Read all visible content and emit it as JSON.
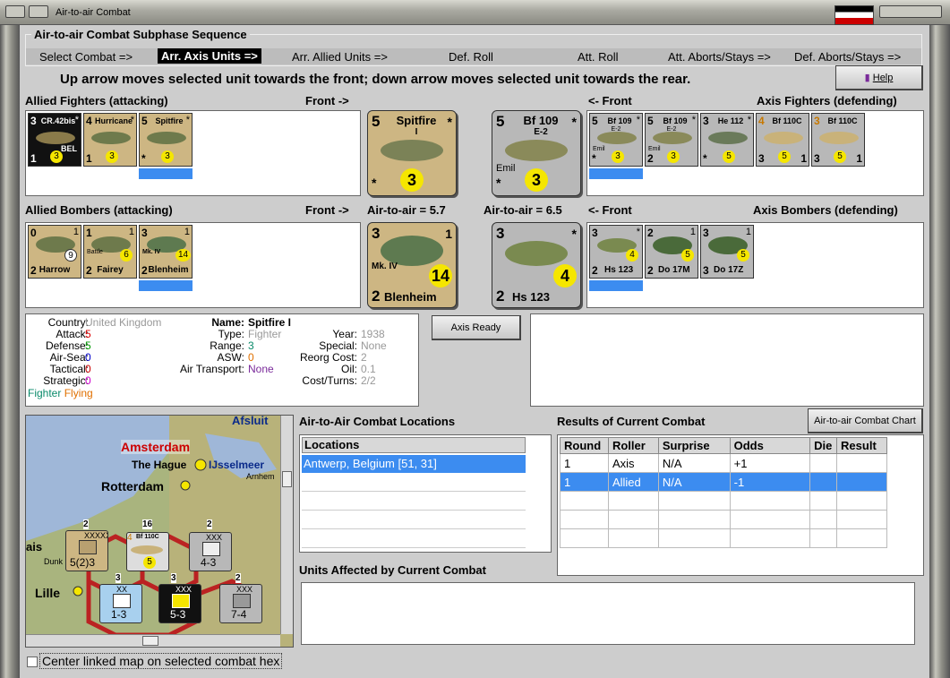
{
  "window": {
    "title": "Air-to-air Combat"
  },
  "sequence": {
    "legend": "Air-to-air Combat Subphase Sequence",
    "steps": [
      "Select Combat =>",
      "Arr. Axis Units =>",
      "Arr. Allied Units =>",
      "Def. Roll",
      "Att. Roll",
      "Att. Aborts/Stays =>",
      "Def. Aborts/Stays =>"
    ]
  },
  "instruction": "Up arrow moves selected unit towards the front; down arrow moves selected unit towards the rear.",
  "help_label": "Help",
  "allied_fighters": {
    "title": "Allied Fighters (attacking)",
    "front": "Front ->",
    "units": [
      {
        "a": "3",
        "name": "CR.42bis",
        "star": "*",
        "d": "1",
        "circ": "3",
        "extra": "BEL",
        "bg": "#111"
      },
      {
        "a": "4",
        "name": "Hurricane",
        "star": "*",
        "d": "1",
        "circ": "3",
        "bg": "#cdb683"
      },
      {
        "a": "5",
        "name": "Spitfire",
        "star": "*",
        "d": "*",
        "circ": "3",
        "bg": "#cdb683"
      }
    ]
  },
  "axis_fighters": {
    "title": "Axis Fighters (defending)",
    "front": "<- Front",
    "units": [
      {
        "a": "5",
        "name": "Bf 109",
        "sub": "E-2",
        "extra": "Emil",
        "star": "*",
        "d": "*",
        "circ": "3"
      },
      {
        "a": "5",
        "name": "Bf 109",
        "sub": "E-2",
        "extra": "Emil",
        "star": "*",
        "d": "2",
        "circ": "3"
      },
      {
        "a": "3",
        "name": "He 112",
        "star": "*",
        "d": "*",
        "circ": "5"
      },
      {
        "a": "4",
        "name": "Bf 110C",
        "star": "1",
        "d": "3",
        "circ": "5"
      },
      {
        "a": "3",
        "name": "Bf 110C",
        "star": "1",
        "d": "3",
        "circ": "5"
      }
    ]
  },
  "allied_bombers": {
    "title": "Allied Bombers (attacking)",
    "front": "Front ->",
    "ata": "Air-to-air = 5.7",
    "units": [
      {
        "a": "0",
        "name": "Harrow",
        "star": "1",
        "d": "2",
        "circ": "9"
      },
      {
        "a": "1",
        "name": "Fairey",
        "sub": "Battle",
        "star": "1",
        "d": "2",
        "circ": "6"
      },
      {
        "a": "3",
        "name": "Blenheim",
        "sub": "Mk. IV",
        "star": "1",
        "d": "2",
        "circ": "14"
      }
    ]
  },
  "axis_bombers": {
    "title": "Axis Bombers (defending)",
    "front": "<- Front",
    "ata": "Air-to-air = 6.5",
    "units": [
      {
        "a": "3",
        "name": "Hs 123",
        "star": "*",
        "d": "2",
        "circ": "4"
      },
      {
        "a": "2",
        "name": "Do 17M",
        "star": "1",
        "d": "2",
        "circ": "5"
      },
      {
        "a": "3",
        "name": "Do 17Z",
        "star": "1",
        "d": "3",
        "circ": "5"
      }
    ]
  },
  "big_counters": {
    "allied_fighter": {
      "a": "5",
      "name": "Spitfire",
      "sub": "I",
      "star": "*",
      "d": "*",
      "circ": "3"
    },
    "axis_fighter": {
      "a": "5",
      "name": "Bf 109",
      "sub": "E-2",
      "extra": "Emil",
      "star": "*",
      "d": "*",
      "circ": "3"
    },
    "allied_bomber": {
      "a": "3",
      "name": "Blenheim",
      "sub": "Mk. IV",
      "star": "1",
      "d": "2",
      "circ": "14"
    },
    "axis_bomber": {
      "a": "3",
      "name": "Hs 123",
      "star": "*",
      "d": "2",
      "circ": "4"
    }
  },
  "info": {
    "country_l": "Country:",
    "country": "United Kingdom",
    "attack_l": "Attack:",
    "attack": "5",
    "defense_l": "Defense:",
    "defense": "5",
    "airsea_l": "Air-Sea:",
    "airsea": "0",
    "tactical_l": "Tactical:",
    "tactical": "0",
    "strategic_l": "Strategic:",
    "strategic": "0",
    "fighter": "Fighter",
    "flying": "Flying",
    "name_l": "Name:",
    "name": "Spitfire I",
    "type_l": "Type:",
    "type": "Fighter",
    "range_l": "Range:",
    "range": "3",
    "asw_l": "ASW:",
    "asw": "0",
    "airtrans_l": "Air Transport:",
    "airtrans": "None",
    "year_l": "Year:",
    "year": "1938",
    "special_l": "Special:",
    "special": "None",
    "reorg_l": "Reorg Cost:",
    "reorg": "2",
    "oil_l": "Oil:",
    "oil": "0.1",
    "cost_l": "Cost/Turns:",
    "cost": "2/2"
  },
  "axis_ready": "Axis Ready",
  "locations": {
    "title": "Air-to-Air Combat Locations",
    "header": "Locations",
    "rows": [
      "Antwerp, Belgium [51, 31]"
    ]
  },
  "results": {
    "title": "Results of Current Combat",
    "chart_button": "Air-to-air Combat Chart",
    "headers": [
      "Round",
      "Roller",
      "Surprise",
      "Odds",
      "Die",
      "Result"
    ],
    "rows": [
      [
        "1",
        "Axis",
        "N/A",
        "+1",
        "",
        ""
      ],
      [
        "1",
        "Allied",
        "N/A",
        "-1",
        "",
        ""
      ]
    ]
  },
  "affected_title": "Units Affected by Current Combat",
  "map": {
    "labels": [
      "Amsterdam",
      "The Hague",
      "IJsselmeer",
      "Rotterdam",
      "Arnhem",
      "Afsluit",
      "Lille",
      "ais",
      "Dunk"
    ],
    "stacks": [
      {
        "top": "2",
        "mid": "XXXXX",
        "val": "5(2)3"
      },
      {
        "top": "2",
        "mid": "XXX",
        "val": "4-3"
      },
      {
        "top": "3",
        "mid": "XX",
        "val": "1-3"
      },
      {
        "top": "3",
        "mid": "XXX",
        "val": "5-3"
      },
      {
        "top": "2",
        "mid": "XXX",
        "val": "7-4"
      }
    ],
    "plane": {
      "a": "4",
      "name": "Bf 110C",
      "val": "5",
      "top": "16"
    }
  },
  "center_map_label": "Center linked map on selected combat hex"
}
